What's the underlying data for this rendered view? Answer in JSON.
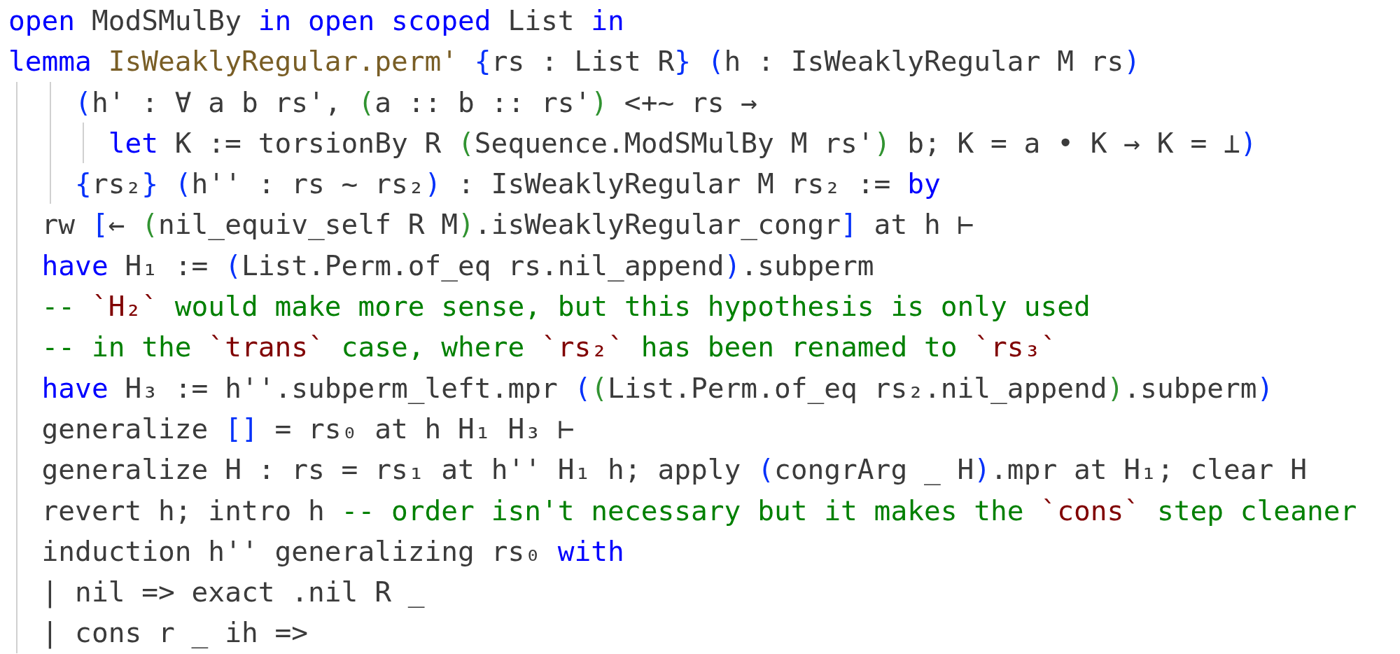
{
  "editor": {
    "lines": [
      {
        "tokens": [
          {
            "kind": "keyword",
            "text": "open"
          },
          {
            "kind": "plain",
            "text": " ModSMulBy "
          },
          {
            "kind": "keyword",
            "text": "in open scoped"
          },
          {
            "kind": "plain",
            "text": " List "
          },
          {
            "kind": "keyword",
            "text": "in"
          }
        ]
      },
      {
        "tokens": [
          {
            "kind": "keyword",
            "text": "lemma"
          },
          {
            "kind": "declaration",
            "text": " IsWeaklyRegular.perm'"
          },
          {
            "kind": "bracket-1",
            "text": " {"
          },
          {
            "kind": "plain",
            "text": "rs : List R"
          },
          {
            "kind": "bracket-1",
            "text": "}"
          },
          {
            "kind": "bracket-1",
            "text": " ("
          },
          {
            "kind": "plain",
            "text": "h : IsWeaklyRegular M rs"
          },
          {
            "kind": "bracket-1",
            "text": ")"
          }
        ]
      },
      {
        "tokens": [
          {
            "kind": "bracket-1",
            "text": "    ("
          },
          {
            "kind": "plain",
            "text": "h' : ∀ a b rs', "
          },
          {
            "kind": "bracket-2",
            "text": "("
          },
          {
            "kind": "plain",
            "text": "a :: b :: rs'"
          },
          {
            "kind": "bracket-2",
            "text": ")"
          },
          {
            "kind": "plain",
            "text": " <+~ rs →"
          }
        ]
      },
      {
        "tokens": [
          {
            "kind": "keyword",
            "text": "      let"
          },
          {
            "kind": "plain",
            "text": " K := torsionBy R "
          },
          {
            "kind": "bracket-2",
            "text": "("
          },
          {
            "kind": "plain",
            "text": "Sequence.ModSMulBy M rs'"
          },
          {
            "kind": "bracket-2",
            "text": ")"
          },
          {
            "kind": "plain",
            "text": " b; K = a • K → K = ⊥"
          },
          {
            "kind": "bracket-1",
            "text": ")"
          }
        ]
      },
      {
        "tokens": [
          {
            "kind": "bracket-1",
            "text": "    {"
          },
          {
            "kind": "plain",
            "text": "rs₂"
          },
          {
            "kind": "bracket-1",
            "text": "}"
          },
          {
            "kind": "bracket-1",
            "text": " ("
          },
          {
            "kind": "plain",
            "text": "h'' : rs ~ rs₂"
          },
          {
            "kind": "bracket-1",
            "text": ")"
          },
          {
            "kind": "plain",
            "text": " : IsWeaklyRegular M rs₂ := "
          },
          {
            "kind": "keyword",
            "text": "by"
          }
        ]
      },
      {
        "tokens": [
          {
            "kind": "plain",
            "text": "  rw "
          },
          {
            "kind": "bracket-1",
            "text": "["
          },
          {
            "kind": "plain",
            "text": "← "
          },
          {
            "kind": "bracket-2",
            "text": "("
          },
          {
            "kind": "plain",
            "text": "nil_equiv_self R M"
          },
          {
            "kind": "bracket-2",
            "text": ")"
          },
          {
            "kind": "plain",
            "text": ".isWeaklyRegular_congr"
          },
          {
            "kind": "bracket-1",
            "text": "]"
          },
          {
            "kind": "plain",
            "text": " at h ⊢"
          }
        ]
      },
      {
        "tokens": [
          {
            "kind": "keyword",
            "text": "  have"
          },
          {
            "kind": "plain",
            "text": " H₁ := "
          },
          {
            "kind": "bracket-1",
            "text": "("
          },
          {
            "kind": "plain",
            "text": "List.Perm.of_eq rs.nil_append"
          },
          {
            "kind": "bracket-1",
            "text": ")"
          },
          {
            "kind": "plain",
            "text": ".subperm"
          }
        ]
      },
      {
        "tokens": [
          {
            "kind": "comment",
            "text": "  -- "
          },
          {
            "kind": "comment-code",
            "text": "`H₂`"
          },
          {
            "kind": "comment",
            "text": " would make more sense, but this hypothesis is only used"
          }
        ]
      },
      {
        "tokens": [
          {
            "kind": "comment",
            "text": "  -- in the "
          },
          {
            "kind": "comment-code",
            "text": "`trans`"
          },
          {
            "kind": "comment",
            "text": " case, where "
          },
          {
            "kind": "comment-code",
            "text": "`rs₂`"
          },
          {
            "kind": "comment",
            "text": " has been renamed to "
          },
          {
            "kind": "comment-code",
            "text": "`rs₃`"
          }
        ]
      },
      {
        "tokens": [
          {
            "kind": "keyword",
            "text": "  have"
          },
          {
            "kind": "plain",
            "text": " H₃ := h''.subperm_left.mpr "
          },
          {
            "kind": "bracket-1",
            "text": "("
          },
          {
            "kind": "bracket-2",
            "text": "("
          },
          {
            "kind": "plain",
            "text": "List.Perm.of_eq rs₂.nil_append"
          },
          {
            "kind": "bracket-2",
            "text": ")"
          },
          {
            "kind": "plain",
            "text": ".subperm"
          },
          {
            "kind": "bracket-1",
            "text": ")"
          }
        ]
      },
      {
        "tokens": [
          {
            "kind": "plain",
            "text": "  generalize "
          },
          {
            "kind": "bracket-1",
            "text": "[]"
          },
          {
            "kind": "plain",
            "text": " = rs₀ at h H₁ H₃ ⊢"
          }
        ]
      },
      {
        "tokens": [
          {
            "kind": "plain",
            "text": "  generalize H : rs = rs₁ at h'' H₁ h; apply "
          },
          {
            "kind": "bracket-1",
            "text": "("
          },
          {
            "kind": "plain",
            "text": "congrArg _ H"
          },
          {
            "kind": "bracket-1",
            "text": ")"
          },
          {
            "kind": "plain",
            "text": ".mpr at H₁; clear H"
          }
        ]
      },
      {
        "tokens": [
          {
            "kind": "plain",
            "text": "  revert h; intro h "
          },
          {
            "kind": "comment",
            "text": "-- order isn't necessary but it makes the "
          },
          {
            "kind": "comment-code",
            "text": "`cons`"
          },
          {
            "kind": "comment",
            "text": " step cleaner"
          }
        ]
      },
      {
        "tokens": [
          {
            "kind": "plain",
            "text": "  induction h'' generalizing rs₀ "
          },
          {
            "kind": "keyword",
            "text": "with"
          }
        ]
      },
      {
        "tokens": [
          {
            "kind": "plain",
            "text": "  | nil => exact .nil R _"
          }
        ]
      },
      {
        "tokens": [
          {
            "kind": "plain",
            "text": "  | cons r _ ih =>"
          }
        ]
      }
    ]
  }
}
